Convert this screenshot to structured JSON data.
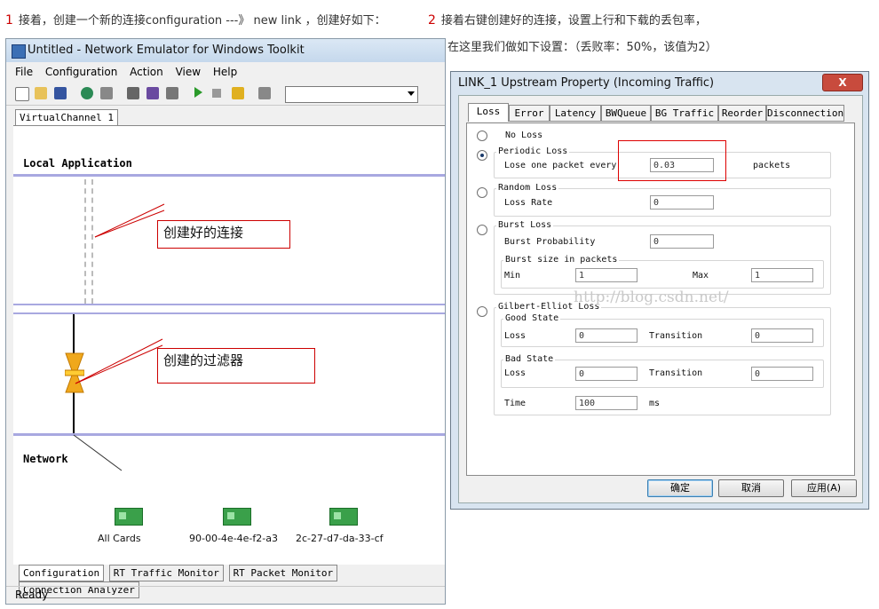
{
  "captions": {
    "step1_num": "1",
    "step1_text": "接着，创建一个新的连接configuration ---》 new link ，创建好如下：",
    "step2_num": "2",
    "step2_text": "接着右键创建好的连接，设置上行和下载的丢包率，",
    "step2_sub": "在这里我们做如下设置：（丢败率：50%，该值为2）"
  },
  "emulator": {
    "title": "Untitled - Network Emulator for Windows Toolkit",
    "menu": [
      "File",
      "Configuration",
      "Action",
      "View",
      "Help"
    ],
    "channel_tab": "VirtualChannel 1",
    "local_app": "Local Application",
    "network": "Network",
    "callout_link": "创建好的连接",
    "callout_filter": "创建的过滤器",
    "cards": [
      "All Cards",
      "90-00-4e-4e-f2-a3",
      "2c-27-d7-da-33-cf"
    ],
    "bottom_tabs": [
      "Configuration",
      "RT Traffic Monitor",
      "RT Packet Monitor",
      "Connection Analyzer"
    ],
    "status": "Ready"
  },
  "dialog": {
    "title": "LINK_1 Upstream Property (Incoming Traffic)",
    "close": "X",
    "tabs": [
      "Loss",
      "Error",
      "Latency",
      "BWQueue",
      "BG Traffic",
      "Reorder",
      "Disconnection"
    ],
    "no_loss": "No Loss",
    "periodic_loss": "Periodic Loss",
    "lose_one_packet_every": "Lose one packet every",
    "periodic_value": "0.03",
    "packets": "packets",
    "random_loss": "Random Loss",
    "loss_rate": "Loss Rate",
    "loss_rate_value": "0",
    "burst_loss": "Burst Loss",
    "burst_probability": "Burst Probability",
    "burst_probability_value": "0",
    "burst_size": "Burst size in packets",
    "min": "Min",
    "min_value": "1",
    "max": "Max",
    "max_value": "1",
    "ge_loss": "Gilbert-Elliot Loss",
    "good_state": "Good State",
    "bad_state": "Bad State",
    "loss": "Loss",
    "transition": "Transition",
    "good_loss_value": "0",
    "good_transition_value": "0",
    "bad_loss_value": "0",
    "bad_transition_value": "0",
    "time": "Time",
    "time_value": "100",
    "ms": "ms",
    "watermark": "http://blog.csdn.net/",
    "ok": "确定",
    "cancel": "取消",
    "apply": "应用(A)"
  }
}
